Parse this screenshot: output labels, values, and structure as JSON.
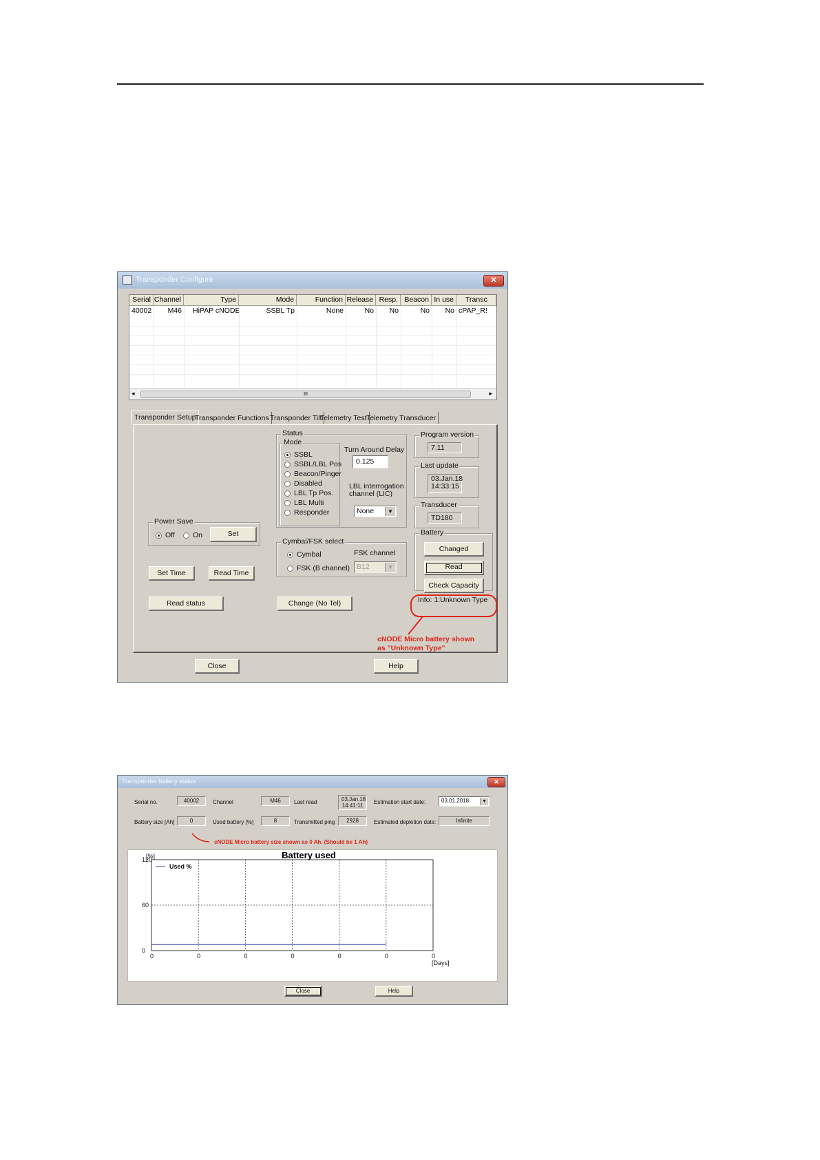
{
  "win1": {
    "title": "Transponder Configure",
    "columns": [
      "Serial",
      "Channel",
      "Type",
      "Mode",
      "Function",
      "Release",
      "Resp.",
      "Beacon",
      "In use",
      "Transc"
    ],
    "row": [
      "40002",
      "M46",
      "HiPAP cNODE",
      "SSBL Tp",
      "None",
      "No",
      "No",
      "No",
      "No",
      "cPAP_R!"
    ],
    "scroll_grip": "III",
    "tabs": [
      "Transponder Setup",
      "Transponder Functions",
      "Transponder Tilt",
      "Telemetry Test",
      "Telemetry Transducer"
    ],
    "status_group": "Status",
    "mode_group": "Mode",
    "modes": [
      "SSBL",
      "SSBL/LBL Pos",
      "Beacon/Pinger",
      "Disabled",
      "LBL Tp Pos.",
      "LBL Multi",
      "Responder"
    ],
    "turn_around_label": "Turn Around Delay",
    "turn_around_value": "0.125",
    "lbl_interrogation_label": "LBL interrogation channel (LIC)",
    "lbl_interrogation_value": "None",
    "program_version_label": "Program version",
    "program_version_value": "7.11",
    "last_update_label": "Last update",
    "last_update_date": "03.Jan.18",
    "last_update_time": "14:33:15",
    "transducer_label": "Transducer",
    "transducer_value": "TD180",
    "power_save_label": "Power Save",
    "off_label": "Off",
    "on_label": "On",
    "set_button": "Set",
    "set_time_button": "Set Time",
    "read_time_button": "Read Time",
    "read_status_button": "Read status",
    "cymbal_group": "Cymbal/FSK select",
    "cymbal_label": "Cymbal",
    "fsk_label": "FSK (B channel)",
    "fsk_channel_label": "FSK channel",
    "fsk_channel_value": "B12",
    "change_button": "Change (No Tel)",
    "battery_group": "Battery",
    "changed_button": "Changed",
    "read_button": "Read",
    "check_capacity_button": "Check Capacity",
    "info_text": "Info: 1:Unknown Type",
    "annotation_line1": "cNODE Micro battery shown",
    "annotation_line2": "as \"Unknown Type\"",
    "close_button": "Close",
    "help_button": "Help"
  },
  "win2": {
    "title": "Transponder battery status",
    "serial_label": "Serial no.",
    "serial_value": "40002",
    "channel_label": "Channel",
    "channel_value": "M46",
    "last_read_label": "Last read",
    "last_read_date": "03.Jan.18",
    "last_read_time": "14:41:11",
    "est_start_label": "Estimation start date:",
    "est_start_value": "03.01.2018",
    "battery_size_label": "Battery size [Ah]",
    "battery_size_value": "0",
    "used_battery_label": "Used battery [%]",
    "used_battery_value": "8",
    "tx_ping_label": "Transmitted ping",
    "tx_ping_value": "2928",
    "est_depletion_label": "Estimated depletion date:",
    "est_depletion_value": "Infinite",
    "annotation": "cNODE Micro battery size shown as 0 Ah. (Should be 1 Ah)",
    "close_button": "Close",
    "help_button": "Help"
  },
  "chart_data": {
    "type": "line",
    "title": "Battery used",
    "ylabel": "[%]",
    "xlabel": "[Days]",
    "ylim": [
      0,
      120
    ],
    "yticks": [
      "120",
      "60",
      "0"
    ],
    "xticks": [
      "0",
      "0",
      "0",
      "0",
      "0",
      "0",
      "0"
    ],
    "grid": true,
    "legend_position": "top-left",
    "series": [
      {
        "name": "Used %",
        "color": "#3b3bb5",
        "x": [
          0,
          5
        ],
        "values": [
          8,
          8
        ]
      }
    ]
  }
}
